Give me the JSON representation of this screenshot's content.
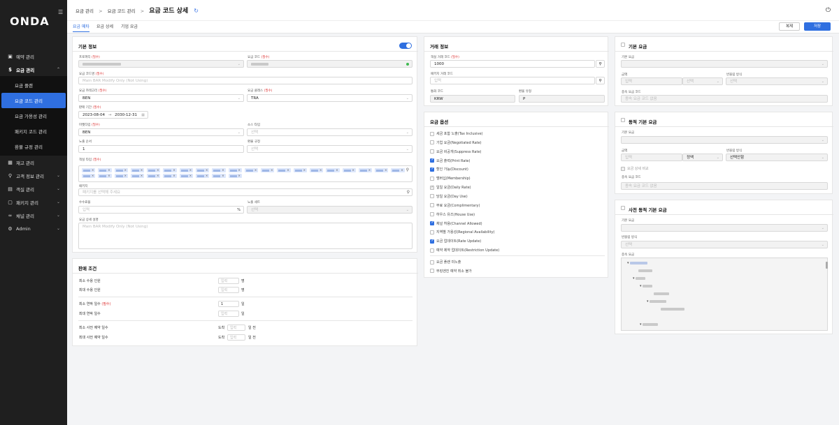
{
  "sidebar": {
    "logo": "ONDA",
    "items": [
      {
        "label": "예약 관리",
        "icon": "calendar-check-icon"
      },
      {
        "label": "요금 관리",
        "icon": "dollar-circle-icon",
        "open": true
      },
      {
        "label": "재고 관리",
        "icon": "inventory-icon"
      },
      {
        "label": "고객 정보 관리",
        "icon": "user-icon"
      },
      {
        "label": "객실 관리",
        "icon": "hotel-icon"
      },
      {
        "label": "패키지 관리",
        "icon": "package-icon"
      },
      {
        "label": "채널 관리",
        "icon": "link-icon"
      },
      {
        "label": "Admin",
        "icon": "gear-icon"
      }
    ],
    "subitems": [
      "요금 플랜",
      "요금 코드 관리",
      "요금 가용성 관리",
      "패키지 코드 관리",
      "환불 규정 관리"
    ]
  },
  "header": {
    "crumb1": "요금 관리",
    "crumb2": "요금 코드 관리",
    "title": "요금 코드 상세"
  },
  "tabs": [
    "요금 메타",
    "요금 상세",
    "기업 요금"
  ],
  "actions": {
    "copy": "복제",
    "save": "저장"
  },
  "basic": {
    "title": "기본 정보",
    "property_label": "프로퍼티",
    "rate_code_label": "요금 코드",
    "rate_code_name_label": "요금 코드명",
    "rate_code_name_value": "Main BAR Modify Only (Not Using)",
    "category_label": "요금 카테고리",
    "category_value": "BEN",
    "class_label": "요금 클래스",
    "class_value": "TRA",
    "period_label": "판매 기간",
    "period_start": "2023-08-04",
    "period_arrow": "→",
    "period_end": "2030-12-31",
    "market_label": "마켓타입",
    "market_value": "BEN",
    "source_label": "소스 타입",
    "source_placeholder": "선택",
    "order_label": "노출 순서",
    "order_value": "1",
    "refund_label": "환불 규정",
    "refund_placeholder": "선택",
    "room_type_label": "객실 타입",
    "package_label": "패키지",
    "package_placeholder": "패키지를 선택해 주세요",
    "commission_label": "수수료율",
    "commission_placeholder": "입력",
    "commission_unit": "%",
    "exposure_label": "노출 세트",
    "exposure_placeholder": "선택",
    "desc_label": "요금 상세 설명",
    "desc_value": "Main BAR Modify Only (Not Using)",
    "required": "(필수)"
  },
  "sales": {
    "title": "판매 조건",
    "min_guests": "최소 수용 인원",
    "max_guests": "최대 수용 인원",
    "min_nights": "최소 연박 일수",
    "min_nights_value": "1",
    "max_nights": "최대 연박 일수",
    "min_advance": "최소 사전 예약 일수",
    "max_advance": "최대 사전 예약 일수",
    "placeholder": "입력",
    "unit_person": "명",
    "unit_day": "일",
    "arrival": "도착",
    "days_before": "일 전",
    "required": "(필수)"
  },
  "trade": {
    "title": "거래 정보",
    "room_trade_label": "객실 거래 코드",
    "room_trade_value": "1000",
    "package_trade_label": "패키지 거래 코드",
    "package_trade_placeholder": "입력",
    "currency_label": "통화 코드",
    "currency_value": "KRW",
    "exchange_label": "환율 유형",
    "exchange_value": "P",
    "required": "(필수)"
  },
  "options": {
    "title": "요금 옵션",
    "items": [
      {
        "label": "세금 포함 노출(Tax Inclusive)",
        "state": "off"
      },
      {
        "label": "기업 요금(Negotiated Rate)",
        "state": "off"
      },
      {
        "label": "요금 비공개(Suppress Rate)",
        "state": "off"
      },
      {
        "label": "요금 출력(Print Rate)",
        "state": "on"
      },
      {
        "label": "할인 가능(Discount)",
        "state": "on"
      },
      {
        "label": "멤버십(Membership)",
        "state": "off"
      },
      {
        "label": "일일 요금(Daily Rate)",
        "state": "gray"
      },
      {
        "label": "당일 요금(Day Use)",
        "state": "off"
      },
      {
        "label": "무료 요금(Complimentary)",
        "state": "off"
      },
      {
        "label": "하우스 유즈(House Use)",
        "state": "off"
      },
      {
        "label": "채널 허용(Channel Allowed)",
        "state": "on"
      },
      {
        "label": "지역별 가용성(Regional Availability)",
        "state": "off"
      },
      {
        "label": "요금 업데이트(Rate Update)",
        "state": "on"
      },
      {
        "label": "예약 제약 업데이트(Restriction Update)",
        "state": "off"
      }
    ],
    "extra": [
      {
        "label": "요금 플랜 미노출",
        "state": "off"
      },
      {
        "label": "부킹엔진 예약 취소 불가",
        "state": "off"
      }
    ]
  },
  "base_rate": {
    "title": "기본 요금",
    "base_label": "기본 요금",
    "amount_label": "금액",
    "amount_placeholder": "입력",
    "select_placeholder": "선택",
    "rounding_label": "반올림 방식",
    "sub_code_label": "종속 요금 코드",
    "sub_code_placeholder": "종속 요금 코드 없음"
  },
  "dynamic_rate": {
    "title": "동적 기본 요금",
    "base_label": "기본 요금",
    "amount_label": "금액",
    "amount_placeholder": "입력",
    "amount_unit": "정액",
    "rounding_label": "반올림 방식",
    "rounding_value": "선택안함",
    "compare_label": "요금 상세 비교",
    "sub_code_label": "종속 요금 코드",
    "sub_code_placeholder": "종속 요금 코드 없음"
  },
  "advance_rate": {
    "title": "사전 동적 기본 요금",
    "base_label": "기본 요금",
    "rounding_label": "반올림 방식",
    "rounding_placeholder": "선택",
    "sub_code_label": "종속 요금"
  }
}
